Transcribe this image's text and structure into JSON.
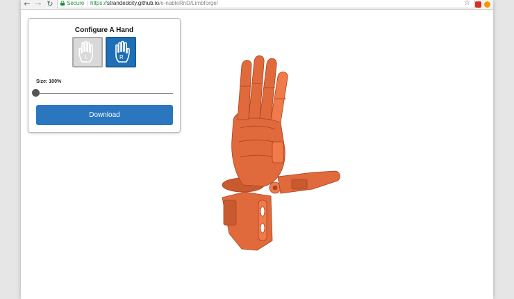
{
  "browser": {
    "secure_label": "Secure",
    "url_scheme": "https://",
    "url_host": "strandedcity.github.io",
    "url_path": "/e-nableRnD/Limbforge/"
  },
  "panel": {
    "title": "Configure A Hand",
    "left_hand_label": "L",
    "right_hand_label": "R",
    "selected_hand": "R",
    "size_label": "Size: 100%",
    "size_value_percent": 100,
    "download_label": "Download"
  },
  "colors": {
    "button_blue": "#2a77c0",
    "model_orange": "#e06a3c",
    "secure_green": "#1e8e3e"
  },
  "icons": [
    "back-icon",
    "forward-icon",
    "reload-icon",
    "lock-icon",
    "star-icon",
    "hand-icon"
  ]
}
